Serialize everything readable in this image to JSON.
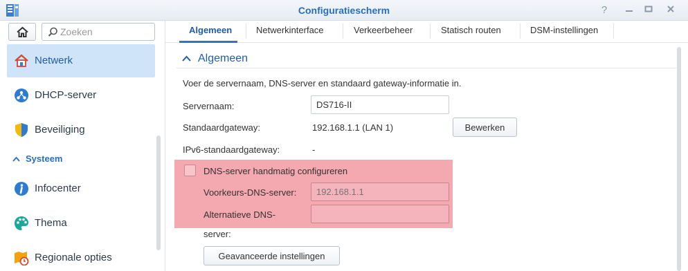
{
  "window": {
    "title": "Configuratiescherm",
    "controls": [
      "help-icon",
      "minimize-icon",
      "maximize-icon",
      "close-icon"
    ]
  },
  "search": {
    "placeholder": "Zoeken",
    "value": ""
  },
  "sidebar": {
    "items": [
      {
        "label": "Netwerk",
        "icon": "network-icon",
        "active": true
      },
      {
        "label": "DHCP-server",
        "icon": "dhcp-icon",
        "active": false
      },
      {
        "label": "Beveiliging",
        "icon": "shield-icon",
        "active": false
      }
    ],
    "section": "Systeem",
    "system_items": [
      {
        "label": "Infocenter",
        "icon": "info-icon"
      },
      {
        "label": "Thema",
        "icon": "palette-icon"
      },
      {
        "label": "Regionale opties",
        "icon": "region-icon"
      }
    ]
  },
  "tabs": [
    "Algemeen",
    "Netwerkinterface",
    "Verkeerbeheer",
    "Statisch routen",
    "DSM-instellingen"
  ],
  "active_tab": "Algemeen",
  "content": {
    "section_title": "Algemeen",
    "intro": "Voer de servernaam, DNS-server en standaard gateway-informatie in.",
    "server_name_label": "Servernaam:",
    "server_name_value": "DS716-II",
    "gateway_label": "Standaardgateway:",
    "gateway_value": "192.168.1.1 (LAN 1)",
    "edit_button": "Bewerken",
    "ipv6_label": "IPv6-standaardgateway:",
    "ipv6_value": "-",
    "dns_checkbox_label": "DNS-server handmatig configureren",
    "preferred_dns_label": "Voorkeurs-DNS-server:",
    "preferred_dns_placeholder": "192.168.1.1",
    "alt_dns_label_1": "Alternatieve DNS-",
    "alt_dns_label_2": "server:",
    "alt_dns_value": "",
    "advanced_button": "Geavanceerde instellingen"
  },
  "colors": {
    "accent": "#2a6ebb",
    "active_nav_bg": "#cfe4f8",
    "highlight": "#f4a8b0"
  }
}
